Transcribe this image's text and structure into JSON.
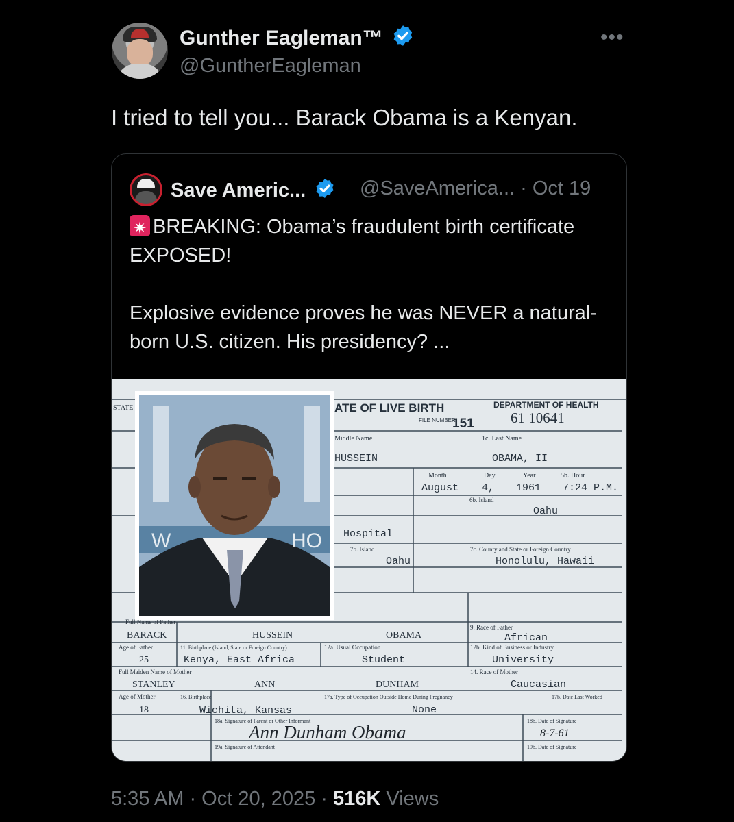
{
  "tweet": {
    "display_name": "Gunther Eagleman™",
    "handle": "@GuntherEagleman",
    "more_label": "•••",
    "text": "I tried to tell you... Barack Obama is a Kenyan.",
    "time": "5:35 AM · Oct 20, 2025 · ",
    "views_count": "516K",
    "views_label": " Views"
  },
  "quoted": {
    "display_name": "Save Americ...",
    "meta": "@SaveAmerica... · Oct 19",
    "line1": "BREAKING: Obama’s fraudulent birth certificate EXPOSED!",
    "line2": "Explosive evidence proves he was NEVER a natural-born U.S. citizen. His presidency? ..."
  },
  "certificate": {
    "state": "STATE",
    "title": "ATE OF LIVE BIRTH",
    "file_label": "FILE NUMBER",
    "file_number": "151",
    "dept": "DEPARTMENT OF HEALTH",
    "dept_number": "61 10641",
    "middle_label": "Middle Name",
    "middle": "HUSSEIN",
    "last_label": "1c. Last Name",
    "last": "OBAMA, II",
    "month_label": "Month",
    "day_label": "Day",
    "year_label": "Year",
    "hour_label": "5b. Hour",
    "month": "August",
    "day": "4,",
    "year": "1961",
    "hour": "7:24 P.M.",
    "island_label": "6b. Island",
    "island": "Oahu",
    "hospital": "Hospital",
    "island2_label": "7b. Island",
    "island2": "Oahu",
    "county_label": "7c. County and State or Foreign Country",
    "county": "Honolulu, Hawaii",
    "father_label": "Full Name of Father",
    "father_first": "BARACK",
    "father_middle": "HUSSEIN",
    "father_last": "OBAMA",
    "race_father_label": "9. Race of Father",
    "race_father": "African",
    "age_father_label": "Age of Father",
    "age_father": "25",
    "birthplace_father_label": "11. Birthplace (Island, State or Foreign Country)",
    "birthplace_father": "Kenya, East Africa",
    "occupation_label": "12a. Usual Occupation",
    "occupation": "Student",
    "business_label": "12b. Kind of Business or Industry",
    "business": "University",
    "mother_label": "Full Maiden Name of Mother",
    "mother_first": "STANLEY",
    "mother_middle": "ANN",
    "mother_last": "DUNHAM",
    "race_mother_label": "14. Race of Mother",
    "race_mother": "Caucasian",
    "age_mother_label": "Age of Mother",
    "age_mother": "18",
    "birthplace_mother_label": "16. Birthplace",
    "birthplace_mother": "Wichita, Kansas",
    "occupation_mother_label": "17a. Type of Occupation Outside Home During Pregnancy",
    "occupation_mother": "None",
    "date_worked_label": "17b. Date Last Worked",
    "signature_label": "18a. Signature of Parent or Other Informant",
    "signature": "Ann Dunham Obama",
    "sig_date_label": "18b. Date of Signature",
    "sig_date": "8-7-61",
    "attendant_label": "19a. Signature of Attendant",
    "sig_date2_label": "19b. Date of Signature"
  },
  "colors": {
    "background": "#000000",
    "text": "#e7e9ea",
    "muted": "#71767b",
    "verified": "#1d9bf0",
    "border": "#2f3336"
  },
  "icons": [
    "verified-badge-icon",
    "more-icon",
    "siren-emoji-icon"
  ]
}
